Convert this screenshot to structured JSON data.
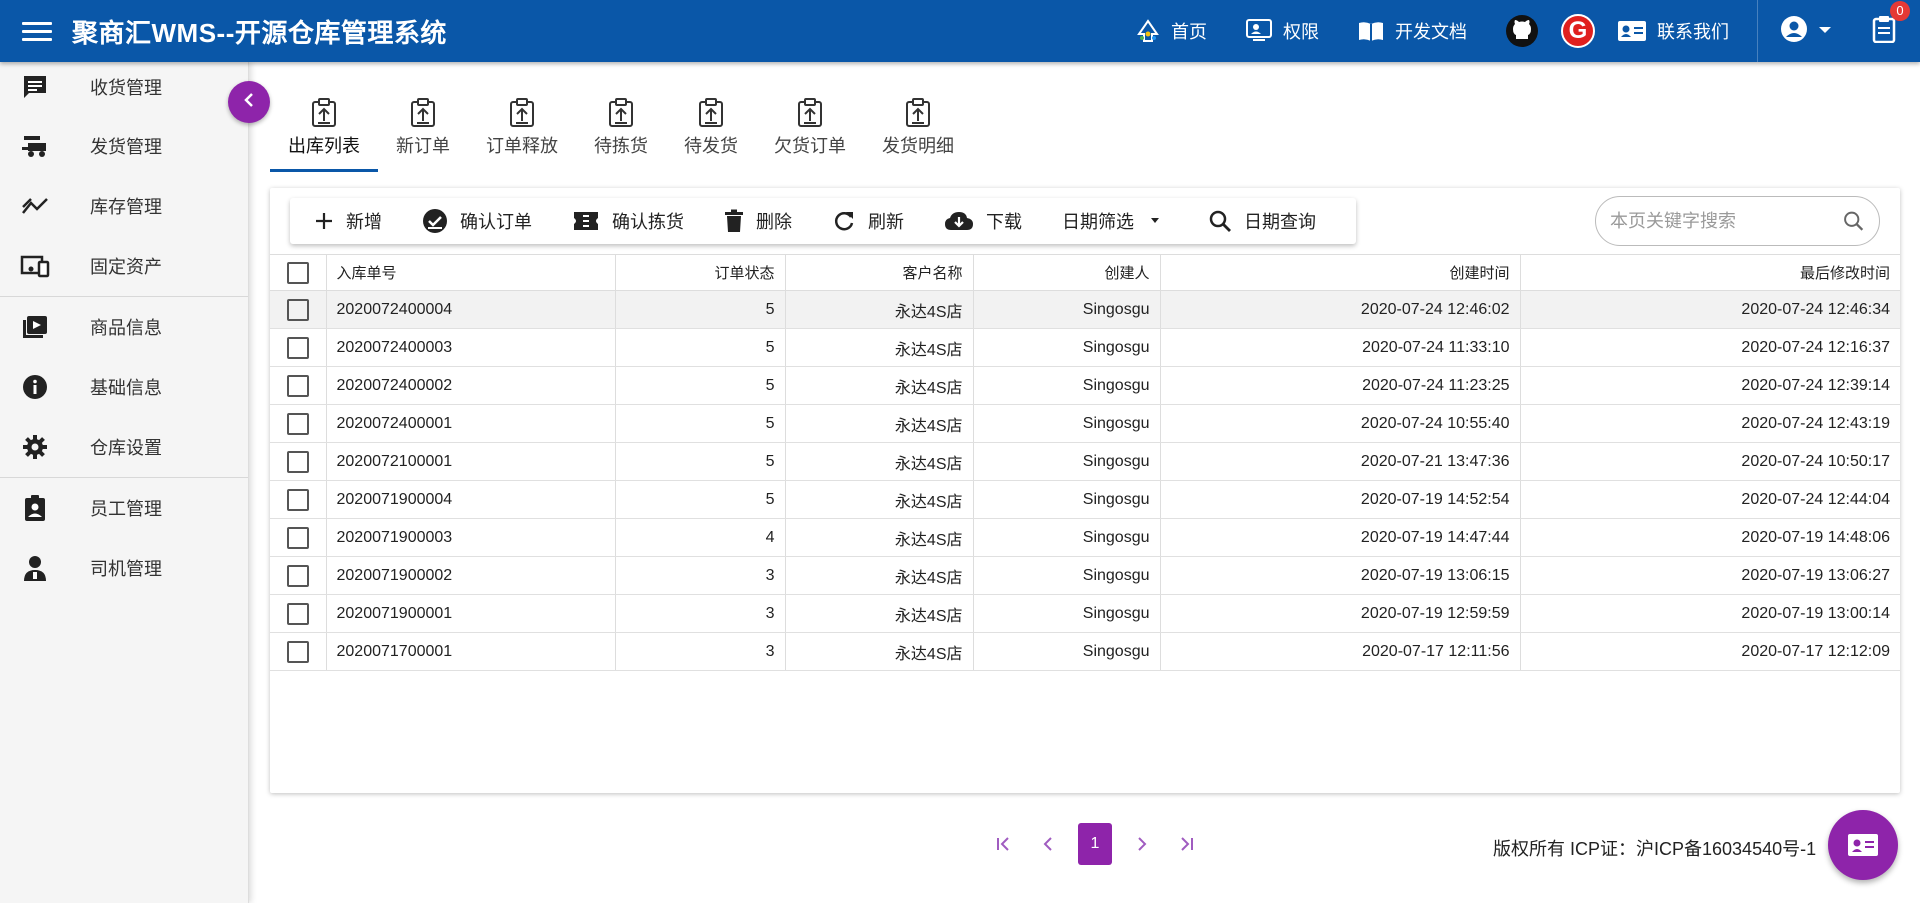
{
  "header": {
    "title": "聚商汇WMS--开源仓库管理系统",
    "nav": [
      {
        "label": "首页",
        "icon": "home-icon"
      },
      {
        "label": "权限",
        "icon": "admin-panel-icon"
      },
      {
        "label": "开发文档",
        "icon": "book-icon"
      }
    ],
    "contact_label": "联系我们",
    "github_icon": "github-icon",
    "gitee_letter": "G",
    "notification_count": "0"
  },
  "sidebar": {
    "items": [
      {
        "label": "收货管理",
        "icon": "receiving-icon"
      },
      {
        "label": "发货管理",
        "icon": "shipping-icon"
      },
      {
        "label": "库存管理",
        "icon": "stock-trend-icon"
      },
      {
        "label": "固定资产",
        "icon": "devices-icon"
      },
      {
        "label": "商品信息",
        "icon": "goods-icon"
      },
      {
        "label": "基础信息",
        "icon": "info-icon"
      },
      {
        "label": "仓库设置",
        "icon": "settings-icon"
      },
      {
        "label": "员工管理",
        "icon": "staff-badge-icon"
      },
      {
        "label": "司机管理",
        "icon": "driver-icon"
      }
    ]
  },
  "tabs": [
    {
      "label": "出库列表",
      "active": true
    },
    {
      "label": "新订单"
    },
    {
      "label": "订单释放"
    },
    {
      "label": "待拣货"
    },
    {
      "label": "待发货"
    },
    {
      "label": "欠货订单"
    },
    {
      "label": "发货明细"
    }
  ],
  "toolbar": {
    "add": "新增",
    "confirm_order": "确认订单",
    "confirm_pick": "确认拣货",
    "delete": "删除",
    "refresh": "刷新",
    "download": "下载",
    "date_filter": "日期筛选",
    "date_query": "日期查询"
  },
  "search": {
    "placeholder": "本页关键字搜索",
    "value": ""
  },
  "table": {
    "columns": [
      "入库单号",
      "订单状态",
      "客户名称",
      "创建人",
      "创建时间",
      "最后修改时间"
    ],
    "rows": [
      [
        "2020072400004",
        "5",
        "永达4S店",
        "Singosgu",
        "2020-07-24 12:46:02",
        "2020-07-24 12:46:34"
      ],
      [
        "2020072400003",
        "5",
        "永达4S店",
        "Singosgu",
        "2020-07-24 11:33:10",
        "2020-07-24 12:16:37"
      ],
      [
        "2020072400002",
        "5",
        "永达4S店",
        "Singosgu",
        "2020-07-24 11:23:25",
        "2020-07-24 12:39:14"
      ],
      [
        "2020072400001",
        "5",
        "永达4S店",
        "Singosgu",
        "2020-07-24 10:55:40",
        "2020-07-24 12:43:19"
      ],
      [
        "2020072100001",
        "5",
        "永达4S店",
        "Singosgu",
        "2020-07-21 13:47:36",
        "2020-07-24 10:50:17"
      ],
      [
        "2020071900004",
        "5",
        "永达4S店",
        "Singosgu",
        "2020-07-19 14:52:54",
        "2020-07-24 12:44:04"
      ],
      [
        "2020071900003",
        "4",
        "永达4S店",
        "Singosgu",
        "2020-07-19 14:47:44",
        "2020-07-19 14:48:06"
      ],
      [
        "2020071900002",
        "3",
        "永达4S店",
        "Singosgu",
        "2020-07-19 13:06:15",
        "2020-07-19 13:06:27"
      ],
      [
        "2020071900001",
        "3",
        "永达4S店",
        "Singosgu",
        "2020-07-19 12:59:59",
        "2020-07-19 13:00:14"
      ],
      [
        "2020071700001",
        "3",
        "永达4S店",
        "Singosgu",
        "2020-07-17 12:11:56",
        "2020-07-17 12:12:09"
      ]
    ]
  },
  "pagination": {
    "current": "1"
  },
  "footer": {
    "copyright": "版权所有 ICP证：沪ICP备16034540号-1"
  },
  "colors": {
    "header": "#0a57a8",
    "accent": "#8e24aa"
  }
}
